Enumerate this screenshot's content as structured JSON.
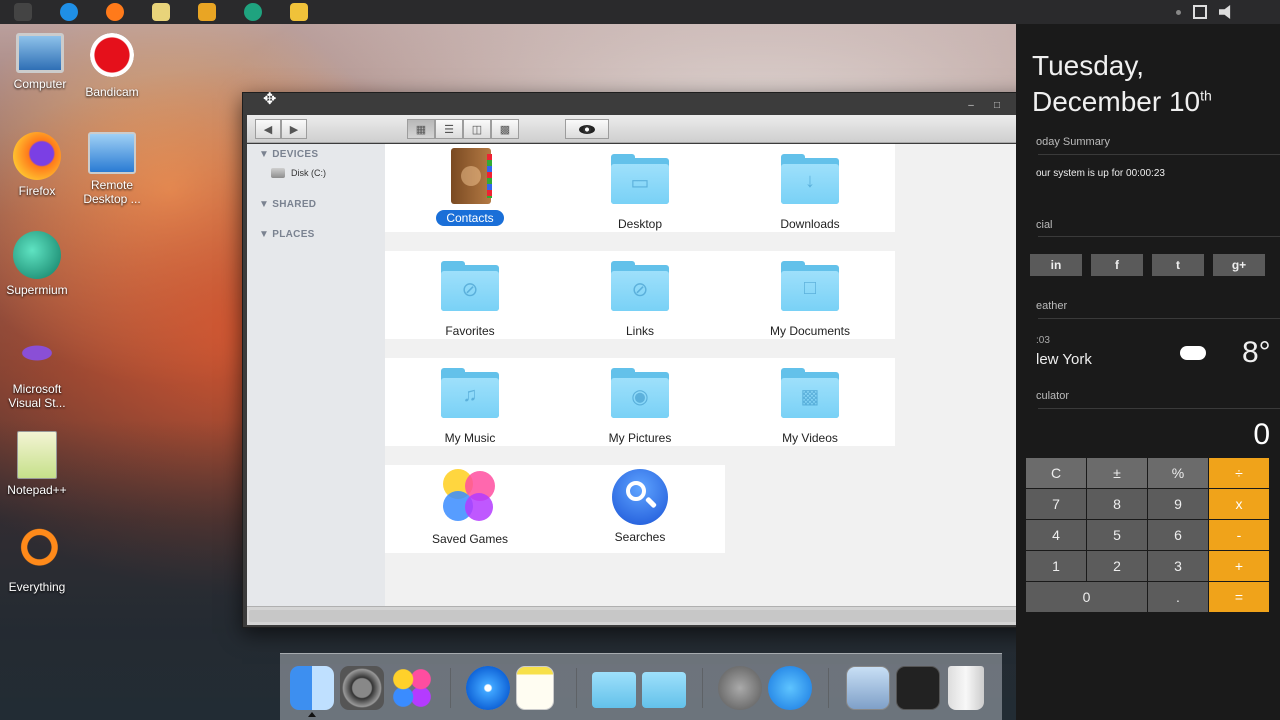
{
  "desktop": {
    "icons": [
      {
        "label": "Computer"
      },
      {
        "label": "Bandicam"
      },
      {
        "label": "Firefox"
      },
      {
        "label": "Remote Desktop ..."
      },
      {
        "label": "Supermium"
      },
      {
        "label": "Microsoft Visual St..."
      },
      {
        "label": "Notepad++"
      },
      {
        "label": "Everything"
      }
    ]
  },
  "finder": {
    "sidebar": {
      "devices": "DEVICES",
      "disk": "Disk (C:)",
      "shared": "SHARED",
      "places": "PLACES"
    },
    "items": [
      {
        "label": "Contacts"
      },
      {
        "label": "Desktop"
      },
      {
        "label": "Downloads"
      },
      {
        "label": "Favorites"
      },
      {
        "label": "Links"
      },
      {
        "label": "My Documents"
      },
      {
        "label": "My Music"
      },
      {
        "label": "My Pictures"
      },
      {
        "label": "My Videos"
      },
      {
        "label": "Saved Games"
      },
      {
        "label": "Searches"
      }
    ],
    "selected": "Contacts"
  },
  "panel": {
    "day": "Tuesday,",
    "date": "December 10",
    "date_suffix": "th",
    "summary_title": "oday Summary",
    "uptime": "our system is up for 00:00:23",
    "social_title": "cial",
    "social": [
      "in",
      "f",
      "t",
      "g+"
    ],
    "weather_title": "eather",
    "weather_time": ":03",
    "weather_city": "lew York",
    "weather_temp": "8°",
    "calc_title": "culator",
    "calc_display": "0",
    "calc_keys": [
      "C",
      "±",
      "%",
      "÷",
      "7",
      "8",
      "9",
      "x",
      "4",
      "5",
      "6",
      "-",
      "1",
      "2",
      "3",
      "+",
      "0",
      ".",
      "="
    ]
  },
  "colors": {
    "accent": "#1a6fd8",
    "folder": "#79d1f6",
    "calc_op": "#f0a31a"
  }
}
